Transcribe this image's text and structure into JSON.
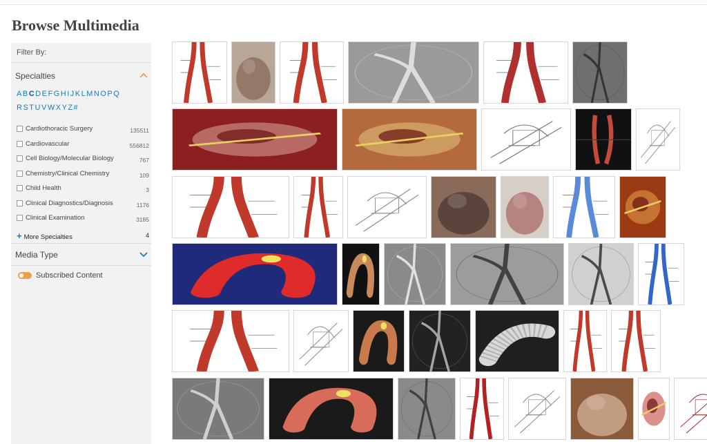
{
  "page": {
    "title": "Browse Multimedia"
  },
  "sidebar": {
    "filter_by": "Filter By:",
    "specialties_heading": "Specialties",
    "letters_row1": [
      "A",
      "B",
      "C",
      "D",
      "E",
      "F",
      "G",
      "H",
      "I",
      "J",
      "K",
      "L",
      "M",
      "N",
      "O",
      "P",
      "Q"
    ],
    "letters_row2": [
      "R",
      "S",
      "T",
      "U",
      "V",
      "W",
      "X",
      "Y",
      "Z",
      "#"
    ],
    "active_letter": "C",
    "specialties": [
      {
        "label": "Cardiothoracic Surgery",
        "count": "135511"
      },
      {
        "label": "Cardiovascular",
        "count": "556812"
      },
      {
        "label": "Cell Biology/Molecular Biology",
        "count": "767"
      },
      {
        "label": "Chemistry/Clinical Chemistry",
        "count": "109"
      },
      {
        "label": "Child Health",
        "count": "3"
      },
      {
        "label": "Clinical Diagnostics/Diagnosis",
        "count": "1176"
      },
      {
        "label": "Clinical Examination",
        "count": "3185"
      }
    ],
    "more_specialties": {
      "label": "More Specialties",
      "count": "4"
    },
    "media_type_heading": "Media Type",
    "subscribed_label": "Subscribed Content",
    "accent_color": "#e8a34a",
    "link_color": "#1a7ab8"
  },
  "gallery": {
    "rows": [
      [
        {
          "kind": "diagram",
          "bg": "#ffffff",
          "fg": "#c0392b"
        },
        {
          "kind": "photo",
          "bg": "#b8a796",
          "fg": "#7d5a4a"
        },
        {
          "kind": "diagram",
          "bg": "#ffffff",
          "fg": "#c0392b"
        },
        {
          "kind": "xray",
          "bg": "#9a9a9a",
          "fg": "#e9e9e9"
        },
        {
          "kind": "diagram",
          "bg": "#ffffff",
          "fg": "#b03030"
        },
        {
          "kind": "xray",
          "bg": "#6f6f6f",
          "fg": "#2b2b2b"
        }
      ],
      [
        {
          "kind": "surgery",
          "bg": "#8c1f1f",
          "fg": "#d9a89a"
        },
        {
          "kind": "surgery",
          "bg": "#b56a3e",
          "fg": "#e0c27a"
        },
        {
          "kind": "sketch",
          "bg": "#ffffff",
          "fg": "#777777"
        },
        {
          "kind": "ct",
          "bg": "#111111",
          "fg": "#c44a3a"
        },
        {
          "kind": "sketch",
          "bg": "#ffffff",
          "fg": "#888888"
        }
      ],
      [
        {
          "kind": "diagram",
          "bg": "#ffffff",
          "fg": "#c0392b"
        },
        {
          "kind": "diagram",
          "bg": "#ffffff",
          "fg": "#c0392b"
        },
        {
          "kind": "sketch",
          "bg": "#ffffff",
          "fg": "#888888"
        },
        {
          "kind": "photo",
          "bg": "#8a6a58",
          "fg": "#3b2c28"
        },
        {
          "kind": "photo",
          "bg": "#d6cfc8",
          "fg": "#a05050"
        },
        {
          "kind": "diagram",
          "bg": "#ffffff",
          "fg": "#5b8bd6"
        },
        {
          "kind": "surgery",
          "bg": "#9c3a14",
          "fg": "#e6a24a"
        }
      ],
      [
        {
          "kind": "model3d",
          "bg": "#1f2a7a",
          "fg": "#e02b2b"
        },
        {
          "kind": "model3d",
          "bg": "#111111",
          "fg": "#c88a5a"
        },
        {
          "kind": "xray",
          "bg": "#8a8a8a",
          "fg": "#efefef"
        },
        {
          "kind": "xray",
          "bg": "#9c9c9c",
          "fg": "#333333"
        },
        {
          "kind": "xray",
          "bg": "#d0d0d0",
          "fg": "#333333"
        },
        {
          "kind": "diagram",
          "bg": "#ffffff",
          "fg": "#3366cc"
        }
      ],
      [
        {
          "kind": "diagram",
          "bg": "#ffffff",
          "fg": "#c0392b"
        },
        {
          "kind": "sketch",
          "bg": "#ffffff",
          "fg": "#888888"
        },
        {
          "kind": "model3d",
          "bg": "#1a1a1a",
          "fg": "#c87a4a"
        },
        {
          "kind": "xray",
          "bg": "#222222",
          "fg": "#bbbbbb"
        },
        {
          "kind": "stent",
          "bg": "#202020",
          "fg": "#d8d8d8"
        },
        {
          "kind": "diagram",
          "bg": "#ffffff",
          "fg": "#c0392b"
        },
        {
          "kind": "diagram",
          "bg": "#ffffff",
          "fg": "#c0392b"
        }
      ],
      [
        {
          "kind": "xray",
          "bg": "#7a7a7a",
          "fg": "#dedede"
        },
        {
          "kind": "model3d",
          "bg": "#1a1a1a",
          "fg": "#d96b5a"
        },
        {
          "kind": "xray",
          "bg": "#8a8a8a",
          "fg": "#333333"
        },
        {
          "kind": "diagram",
          "bg": "#ffffff",
          "fg": "#b22222"
        },
        {
          "kind": "sketch",
          "bg": "#ffffff",
          "fg": "#888888"
        },
        {
          "kind": "photo",
          "bg": "#8a5a3a",
          "fg": "#e8c8b0"
        },
        {
          "kind": "surgery",
          "bg": "#ffffff",
          "fg": "#c0392b"
        },
        {
          "kind": "sketch",
          "bg": "#ffffff",
          "fg": "#b03030"
        }
      ]
    ]
  }
}
